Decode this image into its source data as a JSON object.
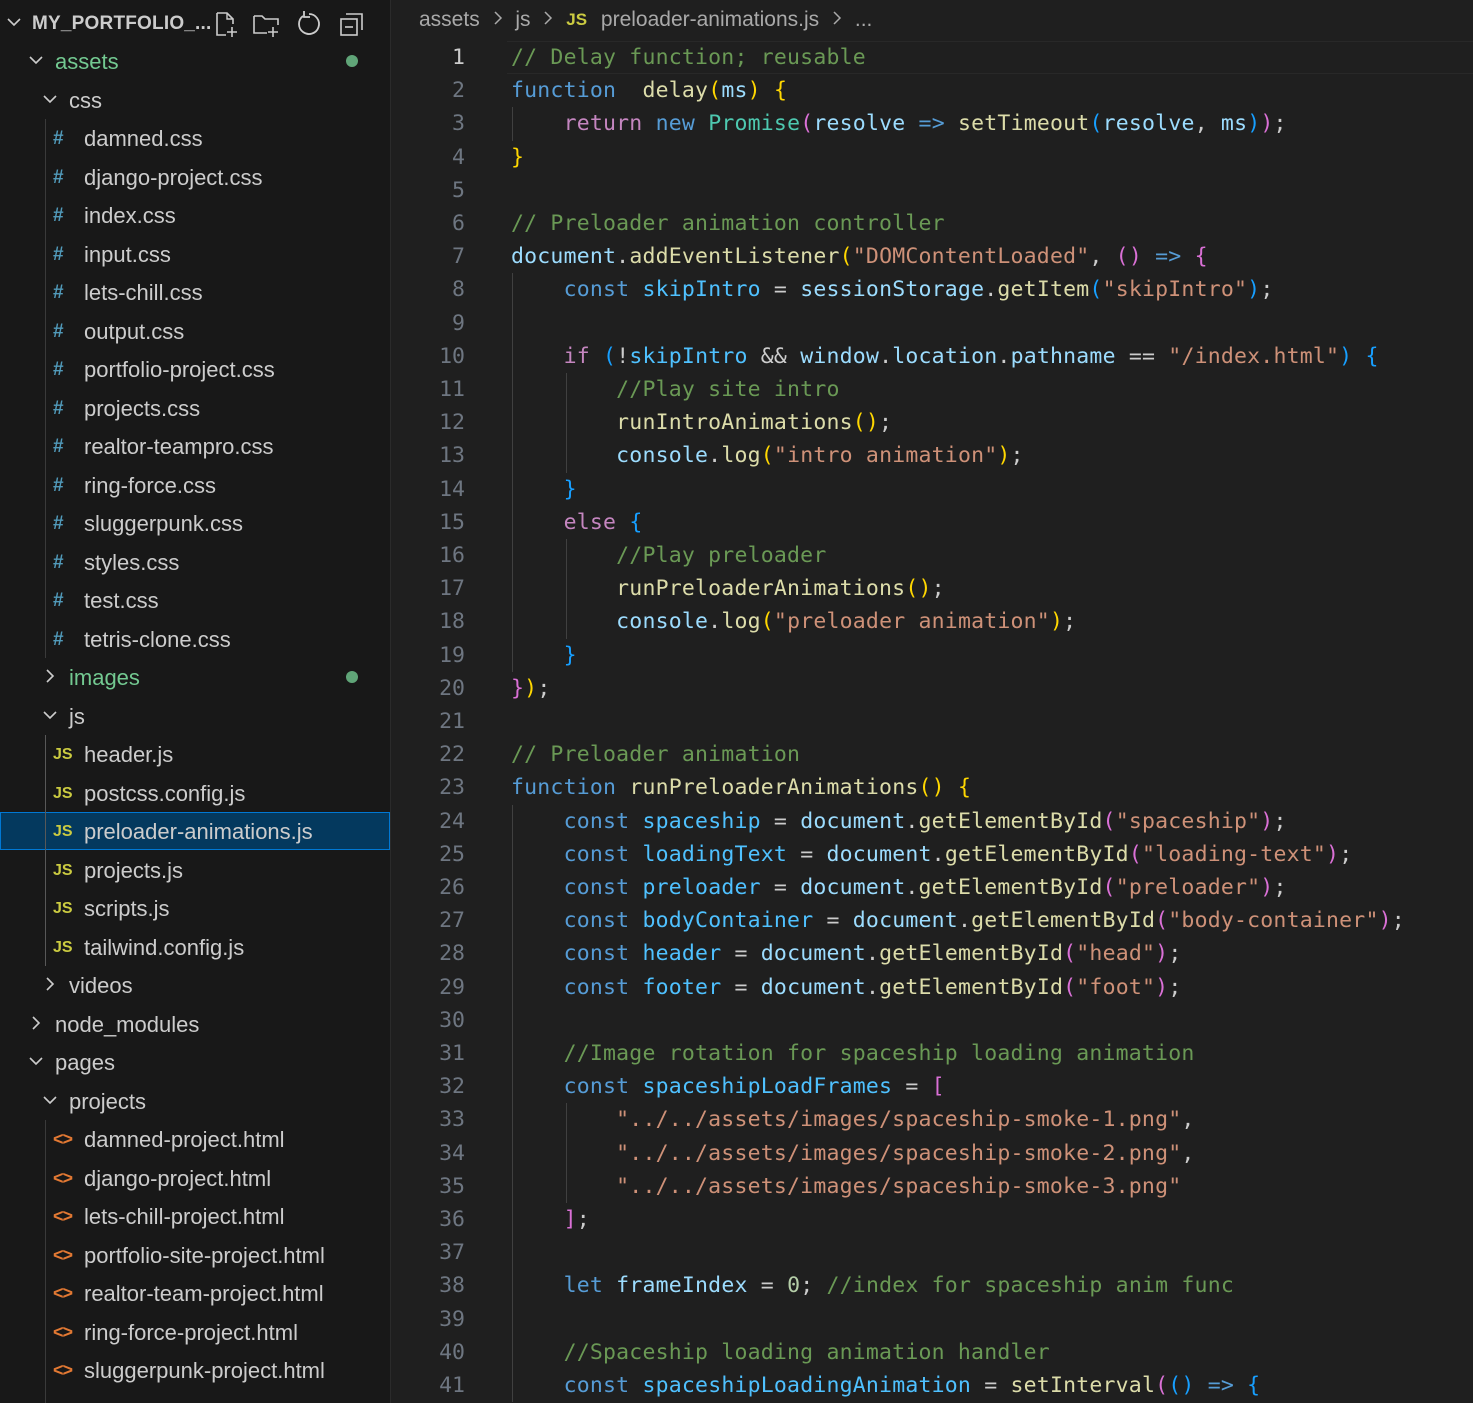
{
  "explorer": {
    "title": "MY_PORTFOLIO_...",
    "actions": [
      "new-file-icon",
      "new-folder-icon",
      "refresh-icon",
      "collapse-all-icon"
    ],
    "items": [
      {
        "label": "assets",
        "type": "folder",
        "depth": 0,
        "expanded": true,
        "modified": true
      },
      {
        "label": "css",
        "type": "folder",
        "depth": 1,
        "expanded": true
      },
      {
        "label": "damned.css",
        "type": "css",
        "depth": 2
      },
      {
        "label": "django-project.css",
        "type": "css",
        "depth": 2
      },
      {
        "label": "index.css",
        "type": "css",
        "depth": 2
      },
      {
        "label": "input.css",
        "type": "css",
        "depth": 2
      },
      {
        "label": "lets-chill.css",
        "type": "css",
        "depth": 2
      },
      {
        "label": "output.css",
        "type": "css",
        "depth": 2
      },
      {
        "label": "portfolio-project.css",
        "type": "css",
        "depth": 2
      },
      {
        "label": "projects.css",
        "type": "css",
        "depth": 2
      },
      {
        "label": "realtor-teampro.css",
        "type": "css",
        "depth": 2
      },
      {
        "label": "ring-force.css",
        "type": "css",
        "depth": 2
      },
      {
        "label": "sluggerpunk.css",
        "type": "css",
        "depth": 2
      },
      {
        "label": "styles.css",
        "type": "css",
        "depth": 2
      },
      {
        "label": "test.css",
        "type": "css",
        "depth": 2
      },
      {
        "label": "tetris-clone.css",
        "type": "css",
        "depth": 2
      },
      {
        "label": "images",
        "type": "folder",
        "depth": 1,
        "expanded": false,
        "modified": true
      },
      {
        "label": "js",
        "type": "folder",
        "depth": 1,
        "expanded": true
      },
      {
        "label": "header.js",
        "type": "js",
        "depth": 2
      },
      {
        "label": "postcss.config.js",
        "type": "js",
        "depth": 2
      },
      {
        "label": "preloader-animations.js",
        "type": "js",
        "depth": 2,
        "selected": true
      },
      {
        "label": "projects.js",
        "type": "js",
        "depth": 2
      },
      {
        "label": "scripts.js",
        "type": "js",
        "depth": 2
      },
      {
        "label": "tailwind.config.js",
        "type": "js",
        "depth": 2
      },
      {
        "label": "videos",
        "type": "folder",
        "depth": 1,
        "expanded": false
      },
      {
        "label": "node_modules",
        "type": "folder",
        "depth": 0,
        "expanded": false
      },
      {
        "label": "pages",
        "type": "folder",
        "depth": 0,
        "expanded": true
      },
      {
        "label": "projects",
        "type": "folder",
        "depth": 1,
        "expanded": true
      },
      {
        "label": "damned-project.html",
        "type": "html",
        "depth": 2
      },
      {
        "label": "django-project.html",
        "type": "html",
        "depth": 2
      },
      {
        "label": "lets-chill-project.html",
        "type": "html",
        "depth": 2
      },
      {
        "label": "portfolio-site-project.html",
        "type": "html",
        "depth": 2
      },
      {
        "label": "realtor-team-project.html",
        "type": "html",
        "depth": 2
      },
      {
        "label": "ring-force-project.html",
        "type": "html",
        "depth": 2
      },
      {
        "label": "sluggerpunk-project.html",
        "type": "html",
        "depth": 2
      }
    ]
  },
  "breadcrumb": {
    "segments": [
      "assets",
      "js",
      "preloader-animations.js",
      "..."
    ],
    "file_badge": "JS"
  },
  "icons": {
    "css": "#",
    "js": "JS",
    "html": "<>"
  },
  "colors": {
    "css_icon": "#519aba",
    "js_icon": "#cbcb41",
    "html_icon": "#e37933",
    "folder_modified": "#73c991",
    "selection": "#04395e",
    "focus_border": "#0078d4"
  },
  "editor": {
    "active_line": 1,
    "lines": [
      [
        [
          "cmt",
          "// Delay function; reusable"
        ]
      ],
      [
        [
          "kw",
          "function"
        ],
        [
          "",
          "  "
        ],
        [
          "fn",
          "delay"
        ],
        [
          "p1",
          "("
        ],
        [
          "var",
          "ms"
        ],
        [
          "p1",
          ")"
        ],
        [
          "",
          " "
        ],
        [
          "p1",
          "{"
        ]
      ],
      [
        [
          "",
          " "
        ],
        [
          "ctl",
          "return"
        ],
        [
          "",
          " "
        ],
        [
          "kw",
          "new"
        ],
        [
          "",
          " "
        ],
        [
          "cls",
          "Promise"
        ],
        [
          "p2",
          "("
        ],
        [
          "var",
          "resolve"
        ],
        [
          "",
          " "
        ],
        [
          "kw",
          "=>"
        ],
        [
          "",
          " "
        ],
        [
          "fn",
          "setTimeout"
        ],
        [
          "p3",
          "("
        ],
        [
          "var",
          "resolve"
        ],
        [
          "",
          ", "
        ],
        [
          "var",
          "ms"
        ],
        [
          "p3",
          ")"
        ],
        [
          "p2",
          ")"
        ],
        [
          "",
          ";"
        ]
      ],
      [
        [
          "p1",
          "}"
        ]
      ],
      [],
      [
        [
          "cmt",
          "// Preloader animation controller"
        ]
      ],
      [
        [
          "var",
          "document"
        ],
        [
          "",
          "."
        ],
        [
          "fn",
          "addEventListener"
        ],
        [
          "p1",
          "("
        ],
        [
          "str",
          "\"DOMContentLoaded\""
        ],
        [
          "",
          ", "
        ],
        [
          "p2",
          "()"
        ],
        [
          "",
          " "
        ],
        [
          "kw",
          "=>"
        ],
        [
          "",
          " "
        ],
        [
          "p2",
          "{"
        ]
      ],
      [
        [
          "",
          " "
        ],
        [
          "kw",
          "const"
        ],
        [
          "",
          " "
        ],
        [
          "cst",
          "skipIntro"
        ],
        [
          "",
          " = "
        ],
        [
          "var",
          "sessionStorage"
        ],
        [
          "",
          "."
        ],
        [
          "fn",
          "getItem"
        ],
        [
          "p3",
          "("
        ],
        [
          "str",
          "\"skipIntro\""
        ],
        [
          "p3",
          ")"
        ],
        [
          "",
          ";"
        ]
      ],
      [],
      [
        [
          "",
          " "
        ],
        [
          "ctl",
          "if"
        ],
        [
          "",
          " "
        ],
        [
          "p3",
          "("
        ],
        [
          "",
          "!"
        ],
        [
          "cst",
          "skipIntro"
        ],
        [
          "",
          " && "
        ],
        [
          "var",
          "window"
        ],
        [
          "",
          "."
        ],
        [
          "var",
          "location"
        ],
        [
          "",
          "."
        ],
        [
          "var",
          "pathname"
        ],
        [
          "",
          " == "
        ],
        [
          "str",
          "\"/index.html\""
        ],
        [
          "p3",
          ")"
        ],
        [
          "",
          " "
        ],
        [
          "p3",
          "{"
        ]
      ],
      [
        [
          "",
          "  "
        ],
        [
          "cmt",
          "//Play site intro"
        ]
      ],
      [
        [
          "",
          "  "
        ],
        [
          "fn",
          "runIntroAnimations"
        ],
        [
          "p1",
          "()"
        ],
        [
          "",
          ";"
        ]
      ],
      [
        [
          "",
          "  "
        ],
        [
          "var",
          "console"
        ],
        [
          "",
          "."
        ],
        [
          "fn",
          "log"
        ],
        [
          "p1",
          "("
        ],
        [
          "str",
          "\"intro animation\""
        ],
        [
          "p1",
          ")"
        ],
        [
          "",
          ";"
        ]
      ],
      [
        [
          "",
          " "
        ],
        [
          "p3",
          "}"
        ]
      ],
      [
        [
          "",
          " "
        ],
        [
          "ctl",
          "else"
        ],
        [
          "",
          " "
        ],
        [
          "p3",
          "{"
        ]
      ],
      [
        [
          "",
          "  "
        ],
        [
          "cmt",
          "//Play preloader"
        ]
      ],
      [
        [
          "",
          "  "
        ],
        [
          "fn",
          "runPreloaderAnimations"
        ],
        [
          "p1",
          "()"
        ],
        [
          "",
          ";"
        ]
      ],
      [
        [
          "",
          "  "
        ],
        [
          "var",
          "console"
        ],
        [
          "",
          "."
        ],
        [
          "fn",
          "log"
        ],
        [
          "p1",
          "("
        ],
        [
          "str",
          "\"preloader animation\""
        ],
        [
          "p1",
          ")"
        ],
        [
          "",
          ";"
        ]
      ],
      [
        [
          "",
          " "
        ],
        [
          "p3",
          "}"
        ]
      ],
      [
        [
          "p2",
          "}"
        ],
        [
          "p1",
          ")"
        ],
        [
          "",
          ";"
        ]
      ],
      [],
      [
        [
          "cmt",
          "// Preloader animation"
        ]
      ],
      [
        [
          "kw",
          "function"
        ],
        [
          "",
          " "
        ],
        [
          "fn",
          "runPreloaderAnimations"
        ],
        [
          "p1",
          "()"
        ],
        [
          "",
          " "
        ],
        [
          "p1",
          "{"
        ]
      ],
      [
        [
          "",
          " "
        ],
        [
          "kw",
          "const"
        ],
        [
          "",
          " "
        ],
        [
          "cst",
          "spaceship"
        ],
        [
          "",
          " = "
        ],
        [
          "var",
          "document"
        ],
        [
          "",
          "."
        ],
        [
          "fn",
          "getElementById"
        ],
        [
          "p2",
          "("
        ],
        [
          "str",
          "\"spaceship\""
        ],
        [
          "p2",
          ")"
        ],
        [
          "",
          ";"
        ]
      ],
      [
        [
          "",
          " "
        ],
        [
          "kw",
          "const"
        ],
        [
          "",
          " "
        ],
        [
          "cst",
          "loadingText"
        ],
        [
          "",
          " = "
        ],
        [
          "var",
          "document"
        ],
        [
          "",
          "."
        ],
        [
          "fn",
          "getElementById"
        ],
        [
          "p2",
          "("
        ],
        [
          "str",
          "\"loading-text\""
        ],
        [
          "p2",
          ")"
        ],
        [
          "",
          ";"
        ]
      ],
      [
        [
          "",
          " "
        ],
        [
          "kw",
          "const"
        ],
        [
          "",
          " "
        ],
        [
          "cst",
          "preloader"
        ],
        [
          "",
          " = "
        ],
        [
          "var",
          "document"
        ],
        [
          "",
          "."
        ],
        [
          "fn",
          "getElementById"
        ],
        [
          "p2",
          "("
        ],
        [
          "str",
          "\"preloader\""
        ],
        [
          "p2",
          ")"
        ],
        [
          "",
          ";"
        ]
      ],
      [
        [
          "",
          " "
        ],
        [
          "kw",
          "const"
        ],
        [
          "",
          " "
        ],
        [
          "cst",
          "bodyContainer"
        ],
        [
          "",
          " = "
        ],
        [
          "var",
          "document"
        ],
        [
          "",
          "."
        ],
        [
          "fn",
          "getElementById"
        ],
        [
          "p2",
          "("
        ],
        [
          "str",
          "\"body-container\""
        ],
        [
          "p2",
          ")"
        ],
        [
          "",
          ";"
        ]
      ],
      [
        [
          "",
          " "
        ],
        [
          "kw",
          "const"
        ],
        [
          "",
          " "
        ],
        [
          "cst",
          "header"
        ],
        [
          "",
          " = "
        ],
        [
          "var",
          "document"
        ],
        [
          "",
          "."
        ],
        [
          "fn",
          "getElementById"
        ],
        [
          "p2",
          "("
        ],
        [
          "str",
          "\"head\""
        ],
        [
          "p2",
          ")"
        ],
        [
          "",
          ";"
        ]
      ],
      [
        [
          "",
          " "
        ],
        [
          "kw",
          "const"
        ],
        [
          "",
          " "
        ],
        [
          "cst",
          "footer"
        ],
        [
          "",
          " = "
        ],
        [
          "var",
          "document"
        ],
        [
          "",
          "."
        ],
        [
          "fn",
          "getElementById"
        ],
        [
          "p2",
          "("
        ],
        [
          "str",
          "\"foot\""
        ],
        [
          "p2",
          ")"
        ],
        [
          "",
          ";"
        ]
      ],
      [],
      [
        [
          "",
          " "
        ],
        [
          "cmt",
          "//Image rotation for spaceship loading animation"
        ]
      ],
      [
        [
          "",
          " "
        ],
        [
          "kw",
          "const"
        ],
        [
          "",
          " "
        ],
        [
          "cst",
          "spaceshipLoadFrames"
        ],
        [
          "",
          " = "
        ],
        [
          "p2",
          "["
        ]
      ],
      [
        [
          "",
          "  "
        ],
        [
          "str",
          "\"../../assets/images/spaceship-smoke-1.png\""
        ],
        [
          "",
          ","
        ]
      ],
      [
        [
          "",
          "  "
        ],
        [
          "str",
          "\"../../assets/images/spaceship-smoke-2.png\""
        ],
        [
          "",
          ","
        ]
      ],
      [
        [
          "",
          "  "
        ],
        [
          "str",
          "\"../../assets/images/spaceship-smoke-3.png\""
        ]
      ],
      [
        [
          "",
          " "
        ],
        [
          "p2",
          "]"
        ],
        [
          "",
          ";"
        ]
      ],
      [],
      [
        [
          "",
          " "
        ],
        [
          "kw",
          "let"
        ],
        [
          "",
          " "
        ],
        [
          "var",
          "frameIndex"
        ],
        [
          "",
          " = "
        ],
        [
          "num",
          "0"
        ],
        [
          "",
          "; "
        ],
        [
          "cmt",
          "//index for spaceship anim func"
        ]
      ],
      [],
      [
        [
          "",
          " "
        ],
        [
          "cmt",
          "//Spaceship loading animation handler"
        ]
      ],
      [
        [
          "",
          " "
        ],
        [
          "kw",
          "const"
        ],
        [
          "",
          " "
        ],
        [
          "cst",
          "spaceshipLoadingAnimation"
        ],
        [
          "",
          " = "
        ],
        [
          "fn",
          "setInterval"
        ],
        [
          "p2",
          "("
        ],
        [
          "p3",
          "()"
        ],
        [
          "",
          " "
        ],
        [
          "kw",
          "=>"
        ],
        [
          "",
          " "
        ],
        [
          "p3",
          "{"
        ]
      ]
    ]
  }
}
